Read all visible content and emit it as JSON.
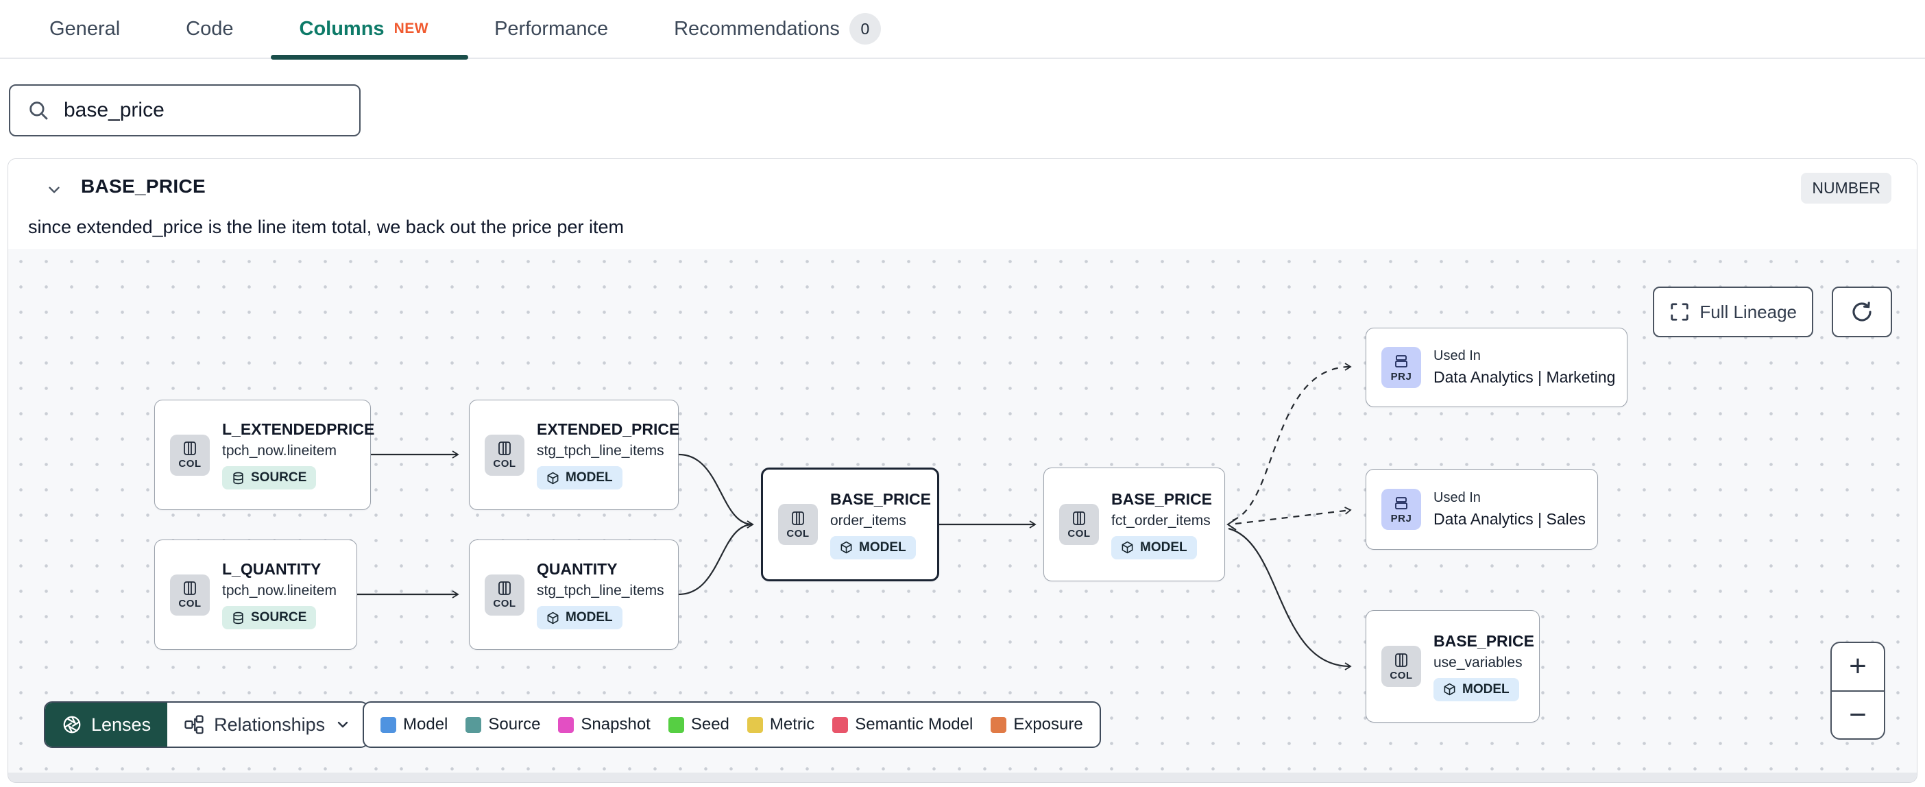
{
  "tabs": {
    "items": [
      {
        "label": "General"
      },
      {
        "label": "Code"
      },
      {
        "label": "Columns",
        "badge": "NEW",
        "active": true
      },
      {
        "label": "Performance"
      },
      {
        "label": "Recommendations",
        "count": "0"
      }
    ]
  },
  "search": {
    "value": "base_price"
  },
  "column_panel": {
    "title": "BASE_PRICE",
    "type_badge": "NUMBER",
    "description": "since extended_price is the line item total, we back out the price per item"
  },
  "lineage": {
    "controls": {
      "full_lineage_label": "Full Lineage",
      "zoom_in": "+",
      "zoom_out": "−"
    },
    "nodes": [
      {
        "chip": "COL",
        "title": "L_EXTENDEDPRICE",
        "subtitle": "tpch_now.lineitem",
        "badge": "SOURCE"
      },
      {
        "chip": "COL",
        "title": "L_QUANTITY",
        "subtitle": "tpch_now.lineitem",
        "badge": "SOURCE"
      },
      {
        "chip": "COL",
        "title": "EXTENDED_PRICE",
        "subtitle": "stg_tpch_line_items",
        "badge": "MODEL"
      },
      {
        "chip": "COL",
        "title": "QUANTITY",
        "subtitle": "stg_tpch_line_items",
        "badge": "MODEL"
      },
      {
        "chip": "COL",
        "title": "BASE_PRICE",
        "subtitle": "order_items",
        "badge": "MODEL"
      },
      {
        "chip": "COL",
        "title": "BASE_PRICE",
        "subtitle": "fct_order_items",
        "badge": "MODEL"
      },
      {
        "chip": "PRJ",
        "eyebrow": "Used In",
        "title": "Data Analytics | Marketing"
      },
      {
        "chip": "PRJ",
        "eyebrow": "Used In",
        "title": "Data Analytics | Sales"
      },
      {
        "chip": "COL",
        "title": "BASE_PRICE",
        "subtitle": "use_variables",
        "badge": "MODEL"
      }
    ],
    "toolbar": {
      "lenses_label": "Lenses",
      "relationships_label": "Relationships"
    },
    "legend": [
      {
        "label": "Model",
        "color": "#4f93e0"
      },
      {
        "label": "Source",
        "color": "#579a99"
      },
      {
        "label": "Snapshot",
        "color": "#e34fc3"
      },
      {
        "label": "Seed",
        "color": "#56cf43"
      },
      {
        "label": "Metric",
        "color": "#e5c84a"
      },
      {
        "label": "Semantic Model",
        "color": "#e8556a"
      },
      {
        "label": "Exposure",
        "color": "#e07a46"
      }
    ]
  },
  "colors": {
    "active_tab_text": "#0d7a68",
    "active_tab_underline": "#1a4e4a",
    "new_badge": "#f0592e",
    "lenses_background": "#1c4f46",
    "selected_node_border": "#1b2433"
  }
}
